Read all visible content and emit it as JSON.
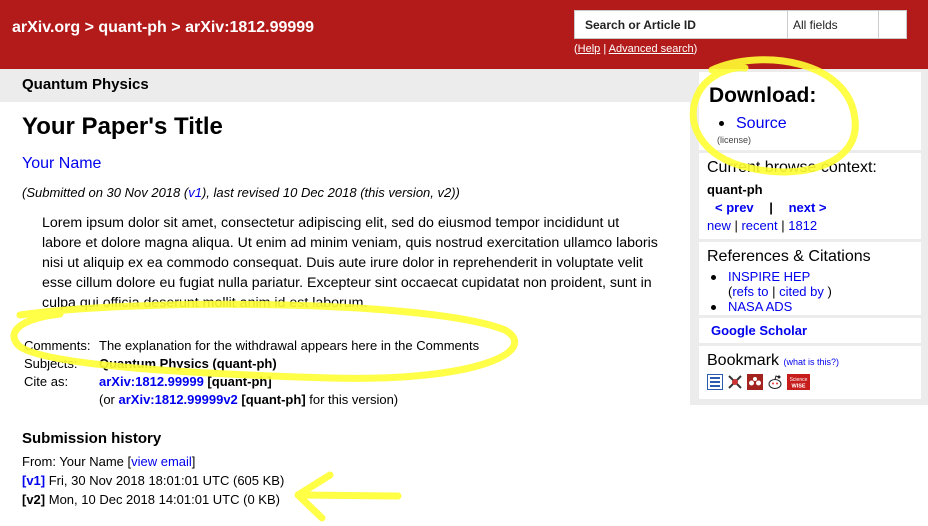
{
  "header": {
    "breadcrumb": "arXiv.org > quant-ph > arXiv:1812.99999",
    "search_placeholder": "Search or Article ID",
    "search_field_value": "All fields",
    "help_prefix": "(",
    "help_label": "Help",
    "help_sep": " | ",
    "advanced_label": "Advanced search",
    "help_suffix": ")"
  },
  "subject_bar": {
    "title": "Quantum Physics"
  },
  "paper": {
    "title": "Your Paper's Title",
    "author": "Your Name",
    "dateline": {
      "prefix": "(Submitted on 30 Nov 2018 (",
      "v1_link": "v1",
      "suffix": "), last revised 10 Dec 2018 (this version, v2))"
    },
    "abstract": "Lorem ipsum dolor sit amet, consectetur adipiscing elit, sed do eiusmod tempor incididunt ut labore et dolore magna aliqua. Ut enim ad minim veniam, quis nostrud exercitation ullamco laboris nisi ut aliquip ex ea commodo consequat. Duis aute irure dolor in reprehenderit in voluptate velit esse cillum dolore eu fugiat nulla pariatur. Excepteur sint occaecat cupidatat non proident, sunt in culpa qui officia deserunt mollit anim id est laborum."
  },
  "metadata": {
    "comments_label": "Comments:",
    "comments_value": "The explanation for the withdrawal appears here in the Comments",
    "subjects_label": "Subjects:",
    "subjects_value": "Quantum Physics (quant-ph)",
    "cite_label": "Cite as:",
    "cite_link": "arXiv:1812.99999",
    "cite_suffix": " [quant-ph]",
    "version_prefix": "(or ",
    "version_link": "arXiv:1812.99999v2",
    "version_bracket": " [quant-ph]",
    "version_suffix": " for this version)"
  },
  "history": {
    "heading": "Submission history",
    "from_prefix": "From: Your Name [",
    "view_email": "view email",
    "from_suffix": "]",
    "versions": [
      {
        "tag": "[v1]",
        "text": " Fri, 30 Nov 2018 18:01:01 UTC (605 KB)",
        "linked": true
      },
      {
        "tag": "[v2]",
        "text": " Mon, 10 Dec 2018 14:01:01 UTC (0 KB)",
        "linked": false
      }
    ]
  },
  "sidebar": {
    "download": {
      "heading": "Download:",
      "source": "Source",
      "license": "(license)"
    },
    "context": {
      "heading": "Current browse context:",
      "category": "quant-ph",
      "prev": "< prev",
      "sep": "|",
      "next": "next >",
      "new": "new",
      "recent": "recent",
      "year": "1812",
      "divider": " | "
    },
    "refs": {
      "heading": "References & Citations",
      "inspire": "INSPIRE HEP",
      "refs_prefix": "(",
      "refs_to": "refs to",
      "refs_sep": " | ",
      "cited_by": "cited by",
      "refs_suffix": " )",
      "nasa": "NASA ADS"
    },
    "scholar": "Google Scholar",
    "bookmark": {
      "heading": "Bookmark",
      "what": "(what is this?)",
      "icons": [
        "bibsonomy-icon",
        "citeulike-icon",
        "mendeley-icon",
        "reddit-icon",
        "sciencewise-icon"
      ],
      "sciencewise_text": "Science WISE"
    }
  },
  "colors": {
    "header_bg": "#b31b1b",
    "link": "#0000ee",
    "panel_bg": "#ececec",
    "annotation": "#ffff33"
  }
}
